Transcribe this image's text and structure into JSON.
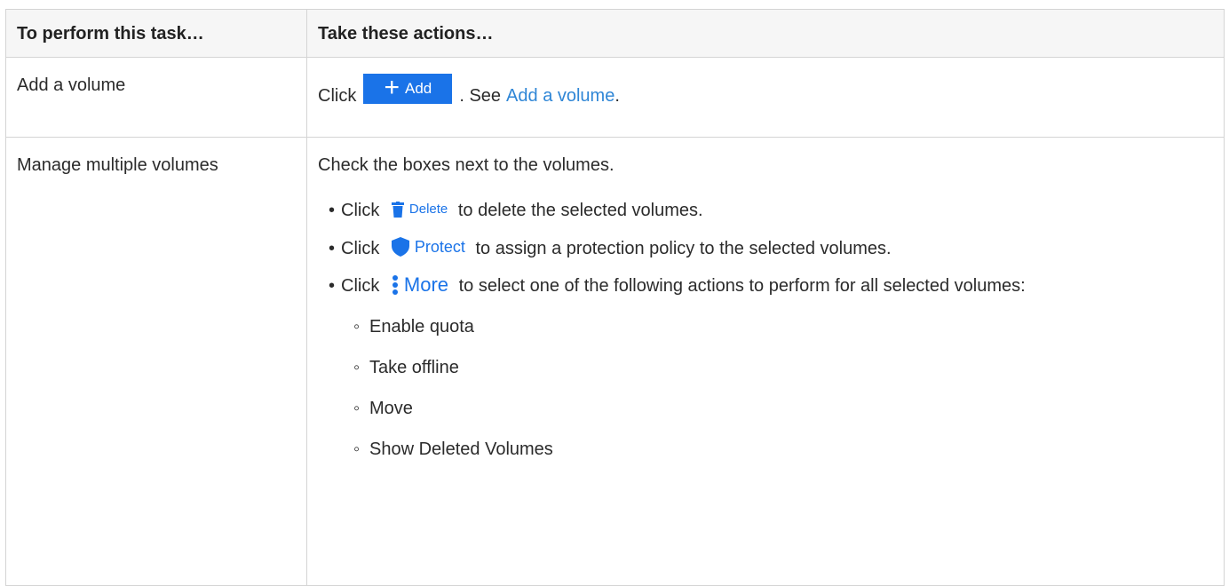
{
  "table": {
    "headers": [
      "To perform this task…",
      "Take these actions…"
    ],
    "row_add": {
      "task": "Add a volume",
      "prefix": "Click",
      "button_label": "Add",
      "middle": ". See",
      "link_text": "Add a volume",
      "suffix": "."
    },
    "row_manage": {
      "task": "Manage multiple volumes",
      "intro": "Check the boxes next to the volumes.",
      "bullets": [
        {
          "prefix": "Click",
          "button_label": "Delete",
          "icon": "trash-icon",
          "text": "to delete the selected volumes."
        },
        {
          "prefix": "Click",
          "button_label": "Protect",
          "icon": "shield-icon",
          "text": "to assign a protection policy to the selected volumes."
        },
        {
          "prefix": "Click",
          "button_label": "More",
          "icon": "kebab-icon",
          "text": "to select one of the following actions to perform for all selected volumes:"
        }
      ],
      "more_actions": [
        "Enable quota",
        "Take offline",
        "Move",
        "Show Deleted Volumes"
      ]
    }
  },
  "colors": {
    "accent": "#1a73e8",
    "link": "#2f86d6",
    "header_bg": "#f6f6f6",
    "border": "#d4d4d4"
  }
}
